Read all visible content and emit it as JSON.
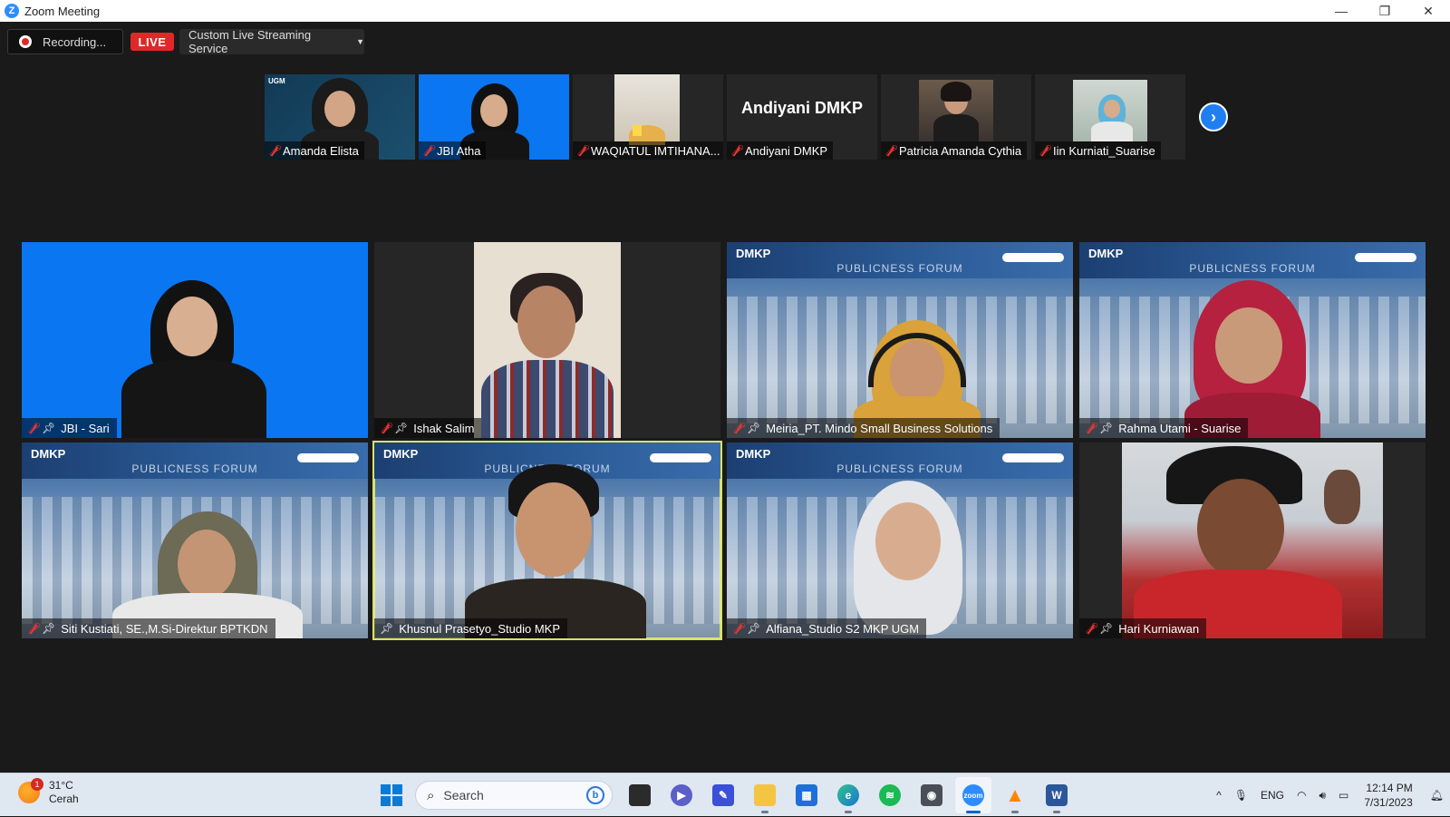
{
  "window": {
    "title": "Zoom Meeting",
    "minimize": "—",
    "restore": "❐",
    "close": "✕"
  },
  "toolbar": {
    "recording_label": "Recording...",
    "live_label": "LIVE",
    "stream_label": "Custom Live Streaming Service"
  },
  "thumbnails": [
    {
      "name": "Amanda Elista"
    },
    {
      "name": "JBI Atha"
    },
    {
      "name": "WAQIATUL IMTIHANA..."
    },
    {
      "name": "Andiyani DMKP",
      "display_text": "Andiyani DMKP"
    },
    {
      "name": "Patricia Amanda Cythia"
    },
    {
      "name": "Iin Kurniati_Suarise"
    }
  ],
  "thumb_next_icon": "chevron-right-icon",
  "forum": {
    "logo": "DMKP",
    "title": "PUBLICNESS FORUM",
    "small_logo": "UGM"
  },
  "gallery": [
    {
      "name": "JBI - Sari"
    },
    {
      "name": "Ishak Salim"
    },
    {
      "name": "Meiria_PT. Mindo Small Business Solutions"
    },
    {
      "name": "Rahma Utami - Suarise"
    },
    {
      "name": "Siti Kustiati, SE.,M.Si-Direktur BPTKDN"
    },
    {
      "name": "Khusnul Prasetyo_Studio MKP"
    },
    {
      "name": "Alfiana_Studio S2 MKP UGM"
    },
    {
      "name": "Hari Kurniawan"
    }
  ],
  "taskbar": {
    "weather_temp": "31°C",
    "weather_desc": "Cerah",
    "weather_badge": "1",
    "search_placeholder": "Search",
    "bing_label": "b",
    "language": "ENG",
    "time": "12:14 PM",
    "date": "7/31/2023",
    "tray_chevron": "^"
  },
  "colors": {
    "accent_blue": "#1f7ff2",
    "live_red": "#e02828",
    "active_speaker": "#d8e36a",
    "muted_red": "#e33333"
  }
}
